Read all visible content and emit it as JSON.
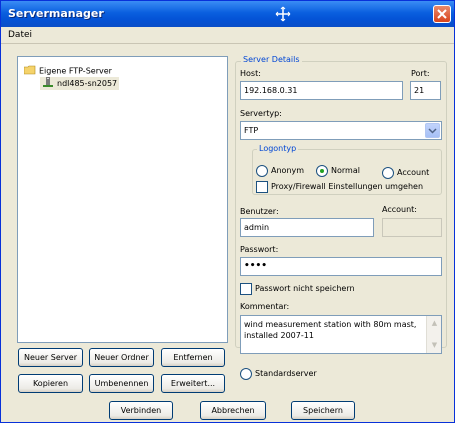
{
  "window": {
    "title": "Servermanager"
  },
  "menu": {
    "items": [
      {
        "label": "Datei"
      }
    ]
  },
  "tree": {
    "root_label": "Eigene FTP-Server",
    "child_label": "ndl485-sn2057"
  },
  "left_buttons": {
    "new_server": "Neuer Server",
    "new_folder": "Neuer Ordner",
    "remove": "Entfernen",
    "copy": "Kopieren",
    "rename": "Umbenennen",
    "extended": "Erweitert..."
  },
  "server_details": {
    "legend": "Server Details",
    "host_label": "Host:",
    "host_value": "192.168.0.31",
    "port_label": "Port:",
    "port_value": "21",
    "servertype_label": "Servertyp:",
    "servertype_value": "FTP",
    "logon": {
      "legend": "Logontyp",
      "anonym": "Anonym",
      "normal": "Normal",
      "account": "Account",
      "selected": "Normal",
      "proxy_label": "Proxy/Firewall Einstellungen umgehen",
      "proxy_checked": false
    },
    "user_label": "Benutzer:",
    "user_value": "admin",
    "account_label": "Account:",
    "account_value": "",
    "password_label": "Passwort:",
    "password_value": "••••",
    "no_save_password_label": "Passwort nicht speichern",
    "no_save_password_checked": false,
    "comment_label": "Kommentar:",
    "comment_value": "wind measurement station with 80m mast, installed 2007-11",
    "default_server_label": "Standardserver"
  },
  "bottom_buttons": {
    "connect": "Verbinden",
    "cancel": "Abbrechen",
    "save": "Speichern"
  },
  "colors": {
    "titlebar": "#0a5fdf",
    "window_bg": "#ece9d8",
    "accent_text": "#0046d5",
    "close": "#d9441c"
  }
}
